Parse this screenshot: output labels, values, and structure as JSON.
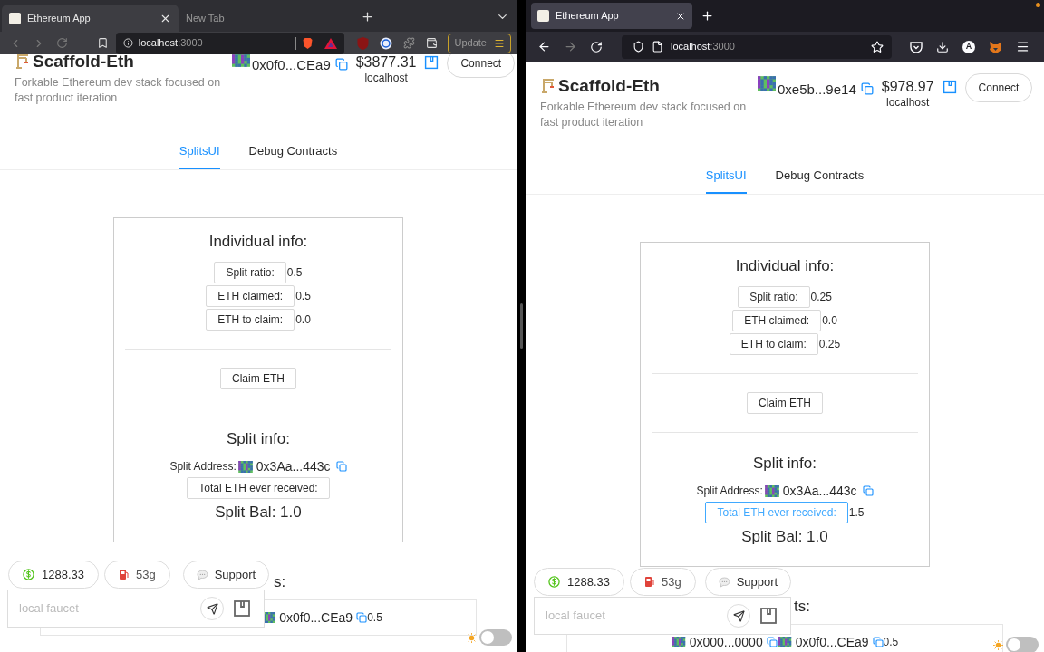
{
  "windows": [
    {
      "kind": "brave",
      "tabs": [
        {
          "title": "Ethereum App",
          "selected": true
        },
        {
          "title": "New Tab",
          "selected": false
        }
      ],
      "url_host": "localhost",
      "url_port": ":3000",
      "update_label": "Update",
      "app": {
        "title": "Scaffold-Eth",
        "subtitle": "Forkable Ethereum dev stack focused on fast product iteration",
        "address": "0x0f0...CEa9",
        "balance": "$3877.31",
        "network": "localhost",
        "connect": "Connect",
        "nav": [
          {
            "label": "SplitsUI",
            "selected": true
          },
          {
            "label": "Debug Contracts",
            "selected": false
          }
        ],
        "individual_title": "Individual info:",
        "info_rows": [
          {
            "label": "Split ratio:",
            "value": "0.5"
          },
          {
            "label": "ETH claimed:",
            "value": "0.5"
          },
          {
            "label": "ETH to claim:",
            "value": "0.0"
          }
        ],
        "claim_button": "Claim ETH",
        "split_title": "Split info:",
        "split_address_label": "Split Address:",
        "split_address": "0x3Aa...443c",
        "total_button": {
          "label": "Total ETH ever received:",
          "focused": false
        },
        "split_bal": "Split Bal: 1.0",
        "recipients_heading": "s:",
        "recipient_addresses": [
          "0x0f0...CEa9"
        ],
        "recipient_value": "0.5",
        "price": "1288.33",
        "gas": "53g",
        "support": "Support",
        "faucet_placeholder": "local faucet",
        "theme_toggle": {
          "on": false
        }
      }
    },
    {
      "kind": "firefox",
      "tabs": [
        {
          "title": "Ethereum App",
          "selected": true
        }
      ],
      "url_host": "localhost",
      "url_port": ":3000",
      "account_initial": "A",
      "app": {
        "title": "Scaffold-Eth",
        "subtitle": "Forkable Ethereum dev stack focused on fast product iteration",
        "address": "0xe5b...9e14",
        "balance": "$978.97",
        "network": "localhost",
        "connect": "Connect",
        "nav": [
          {
            "label": "SplitsUI",
            "selected": true
          },
          {
            "label": "Debug Contracts",
            "selected": false
          }
        ],
        "individual_title": "Individual info:",
        "info_rows": [
          {
            "label": "Split ratio:",
            "value": "0.25"
          },
          {
            "label": "ETH claimed:",
            "value": "0.0"
          },
          {
            "label": "ETH to claim:",
            "value": "0.25"
          }
        ],
        "claim_button": "Claim ETH",
        "split_title": "Split info:",
        "split_address_label": "Split Address:",
        "split_address": "0x3Aa...443c",
        "total_button": {
          "label": "Total ETH ever received:",
          "focused": true
        },
        "total_value": "1.5",
        "split_bal": "Split Bal: 1.0",
        "recipients_heading": "ts:",
        "recipient_addresses": [
          "0x000...0000",
          "0x0f0...CEa9"
        ],
        "recipient_value": "0.5",
        "price": "1288.33",
        "gas": "53g",
        "support": "Support",
        "faucet_placeholder": "local faucet",
        "theme_toggle": {
          "on": false
        }
      }
    }
  ]
}
